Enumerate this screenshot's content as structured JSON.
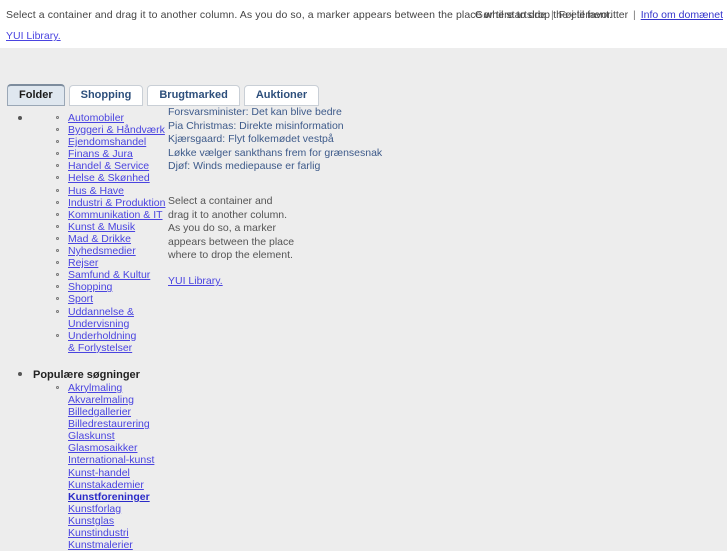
{
  "header": {
    "intro_text": "Select a container and drag it to another column. As you do so, a marker appears between the place where to drop the element.",
    "home_link": "Gør til startside",
    "favorites_link": "Føj til favoritter",
    "domain_link": "Info om domænet",
    "separator": "|",
    "yui_link": "YUI Library."
  },
  "tabs": [
    {
      "label": "Folder"
    },
    {
      "label": "Shopping"
    },
    {
      "label": "Brugtmarked"
    },
    {
      "label": "Auktioner"
    }
  ],
  "sidebar": {
    "categories": [
      {
        "label": "Automobiler"
      },
      {
        "label": "Byggeri & Håndværk"
      },
      {
        "label": "Ejendomshandel"
      },
      {
        "label": "Finans & Jura"
      },
      {
        "label": "Handel & Service"
      },
      {
        "label": "Helse & Skønhed"
      },
      {
        "label": "Hus & Have"
      },
      {
        "label": "Industri & Produktion"
      },
      {
        "label": "Kommunikation & IT"
      },
      {
        "label": "Kunst & Musik"
      },
      {
        "label": "Mad & Drikke"
      },
      {
        "label": "Nyhedsmedier"
      },
      {
        "label": "Rejser"
      },
      {
        "label": "Samfund & Kultur"
      },
      {
        "label": "Shopping"
      },
      {
        "label": "Sport"
      },
      {
        "label": "Uddannelse & Undervisning"
      },
      {
        "label": "Underholdning & Forlystelser"
      }
    ],
    "popular_heading": "Populære søgninger",
    "popular_searches": [
      {
        "label": "Akrylmaling",
        "bold": false
      },
      {
        "label": "Akvarelmaling",
        "bold": false
      },
      {
        "label": "Billedgallerier",
        "bold": false
      },
      {
        "label": "Billedrestaurering",
        "bold": false
      },
      {
        "label": "Glaskunst",
        "bold": false
      },
      {
        "label": "Glasmosaikker",
        "bold": false
      },
      {
        "label": "International-kunst",
        "bold": false
      },
      {
        "label": "Kunst-handel",
        "bold": false
      },
      {
        "label": "Kunstakademier",
        "bold": false
      },
      {
        "label": "Kunstforeninger",
        "bold": true
      },
      {
        "label": "Kunstforlag",
        "bold": false
      },
      {
        "label": "Kunstglas",
        "bold": false
      },
      {
        "label": "Kunstindustri",
        "bold": false
      },
      {
        "label": "Kunstmalerier",
        "bold": false
      }
    ]
  },
  "middle": {
    "news": [
      {
        "headline": "Forsvarsminister: Det kan blive bedre"
      },
      {
        "headline": "Pia Christmas: Direkte misinformation"
      },
      {
        "headline": "Kjærsgaard: Flyt folkemødet vestpå"
      },
      {
        "headline": "Løkke vælger sankthans frem for grænsesnak"
      },
      {
        "headline": "Djøf: Winds mediepause er farlig"
      }
    ],
    "paragraph": "Select a container and drag it to another column. As you do so, a marker appears between the place where to drop the element.",
    "yui_link": "YUI Library."
  },
  "colors": {
    "page_background": "#ededed",
    "header_background": "#ffffff",
    "link": "#4a44e0",
    "tab_active_background": "#dfe7ef",
    "news_text": "#3d5a8a"
  }
}
